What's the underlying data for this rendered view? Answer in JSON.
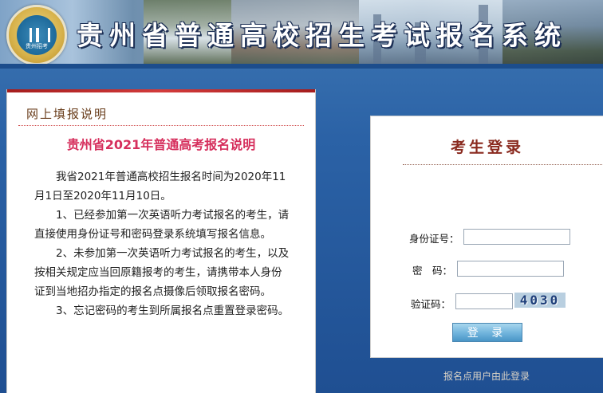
{
  "banner": {
    "title": "贵州省普通高校招生考试报名系统",
    "logo_text": "贵州招考"
  },
  "info_panel": {
    "header": "网上填报说明",
    "title": "贵州省2021年普通高考报名说明",
    "paragraphs": [
      "我省2021年普通高校招生报名时间为2020年11月1日至2020年11月10日。",
      "1、已经参加第一次英语听力考试报名的考生，请直接使用身份证号和密码登录系统填写报名信息。",
      "2、未参加第一次英语听力考试报名的考生，以及按相关规定应当回原籍报考的考生，请携带本人身份证到当地招办指定的报名点摄像后领取报名密码。",
      "3、忘记密码的考生到所属报名点重置登录密码。"
    ]
  },
  "login": {
    "title": "考生登录",
    "id_label": "身份证号：",
    "id_value": "",
    "password_label": "密　码：",
    "password_value": "",
    "captcha_label": "验证码：",
    "captcha_value": "",
    "captcha_image_text": "4030",
    "submit_label": "登 录"
  },
  "footer_link": "报名点用户由此登录"
}
